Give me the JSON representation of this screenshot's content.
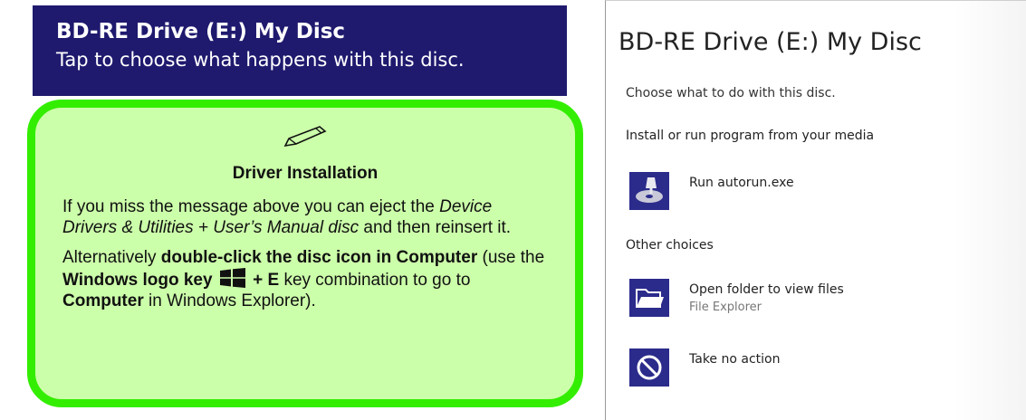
{
  "toast": {
    "title": "BD-RE Drive (E:) My Disc",
    "subtitle": "Tap to choose what happens with this disc."
  },
  "note": {
    "icon": "pencil-icon",
    "title": "Driver Installation",
    "p1_a": "If you miss the message above you can eject the ",
    "p1_em": "Device Drivers & Utilities + User’s Manual disc",
    "p1_b": " and then reinsert it.",
    "p2_a": "Alternatively ",
    "p2_bold1": "double-click the disc icon in Computer",
    "p2_b": " (use the ",
    "p2_bold2": "Windows logo key",
    "p2_bold3": " + E",
    "p2_c": " key combination to go to ",
    "p2_bold4": "Computer",
    "p2_d": " in Windows Explorer).",
    "windows_icon": "windows-logo-icon"
  },
  "dialog": {
    "title": "BD-RE Drive (E:) My Disc",
    "prompt": "Choose what to do with this disc.",
    "section1": "Install or run program from your media",
    "section2": "Other choices",
    "options": [
      {
        "label": "Run autorun.exe",
        "sublabel": "",
        "icon": "installer-icon"
      },
      {
        "label": "Open folder to view files",
        "sublabel": "File Explorer",
        "icon": "folder-icon"
      },
      {
        "label": "Take no action",
        "sublabel": "",
        "icon": "no-action-icon"
      }
    ],
    "accent": "#2b2b8c"
  },
  "colors": {
    "toast_bg": "#1f1a6e",
    "note_bg": "#ccffaa",
    "note_border": "#33ee00"
  }
}
